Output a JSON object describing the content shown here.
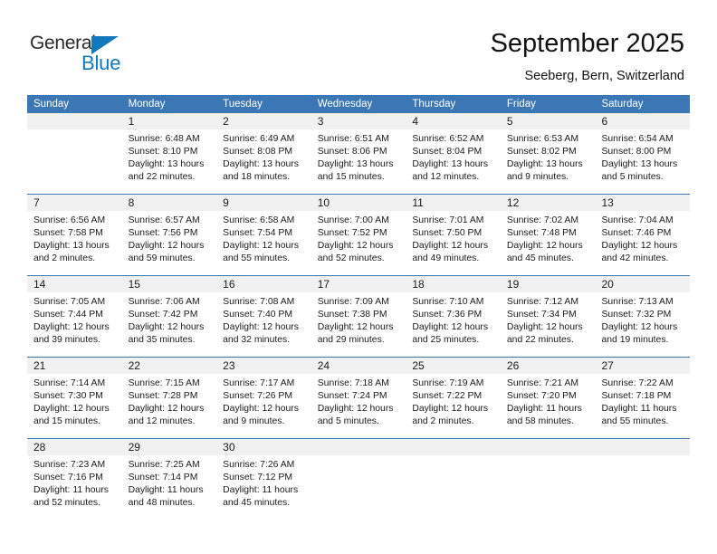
{
  "brand": {
    "name_top": "General",
    "name_bottom": "Blue",
    "color_blue": "#1278be",
    "color_dark": "#2b2b2b",
    "triangle_icon": "blue-triangle-icon"
  },
  "header": {
    "title": "September 2025",
    "subtitle": "Seeberg, Bern, Switzerland"
  },
  "theme": {
    "header_blue": "#3c77b5",
    "band_gray": "#f1f1f1",
    "text_dark": "#1a1a1a"
  },
  "weekdays": [
    "Sunday",
    "Monday",
    "Tuesday",
    "Wednesday",
    "Thursday",
    "Friday",
    "Saturday"
  ],
  "weeks": [
    [
      {
        "day": "",
        "sunrise": "",
        "sunset": "",
        "daylight1": "",
        "daylight2": ""
      },
      {
        "day": "1",
        "sunrise": "Sunrise: 6:48 AM",
        "sunset": "Sunset: 8:10 PM",
        "daylight1": "Daylight: 13 hours",
        "daylight2": "and 22 minutes."
      },
      {
        "day": "2",
        "sunrise": "Sunrise: 6:49 AM",
        "sunset": "Sunset: 8:08 PM",
        "daylight1": "Daylight: 13 hours",
        "daylight2": "and 18 minutes."
      },
      {
        "day": "3",
        "sunrise": "Sunrise: 6:51 AM",
        "sunset": "Sunset: 8:06 PM",
        "daylight1": "Daylight: 13 hours",
        "daylight2": "and 15 minutes."
      },
      {
        "day": "4",
        "sunrise": "Sunrise: 6:52 AM",
        "sunset": "Sunset: 8:04 PM",
        "daylight1": "Daylight: 13 hours",
        "daylight2": "and 12 minutes."
      },
      {
        "day": "5",
        "sunrise": "Sunrise: 6:53 AM",
        "sunset": "Sunset: 8:02 PM",
        "daylight1": "Daylight: 13 hours",
        "daylight2": "and 9 minutes."
      },
      {
        "day": "6",
        "sunrise": "Sunrise: 6:54 AM",
        "sunset": "Sunset: 8:00 PM",
        "daylight1": "Daylight: 13 hours",
        "daylight2": "and 5 minutes."
      }
    ],
    [
      {
        "day": "7",
        "sunrise": "Sunrise: 6:56 AM",
        "sunset": "Sunset: 7:58 PM",
        "daylight1": "Daylight: 13 hours",
        "daylight2": "and 2 minutes."
      },
      {
        "day": "8",
        "sunrise": "Sunrise: 6:57 AM",
        "sunset": "Sunset: 7:56 PM",
        "daylight1": "Daylight: 12 hours",
        "daylight2": "and 59 minutes."
      },
      {
        "day": "9",
        "sunrise": "Sunrise: 6:58 AM",
        "sunset": "Sunset: 7:54 PM",
        "daylight1": "Daylight: 12 hours",
        "daylight2": "and 55 minutes."
      },
      {
        "day": "10",
        "sunrise": "Sunrise: 7:00 AM",
        "sunset": "Sunset: 7:52 PM",
        "daylight1": "Daylight: 12 hours",
        "daylight2": "and 52 minutes."
      },
      {
        "day": "11",
        "sunrise": "Sunrise: 7:01 AM",
        "sunset": "Sunset: 7:50 PM",
        "daylight1": "Daylight: 12 hours",
        "daylight2": "and 49 minutes."
      },
      {
        "day": "12",
        "sunrise": "Sunrise: 7:02 AM",
        "sunset": "Sunset: 7:48 PM",
        "daylight1": "Daylight: 12 hours",
        "daylight2": "and 45 minutes."
      },
      {
        "day": "13",
        "sunrise": "Sunrise: 7:04 AM",
        "sunset": "Sunset: 7:46 PM",
        "daylight1": "Daylight: 12 hours",
        "daylight2": "and 42 minutes."
      }
    ],
    [
      {
        "day": "14",
        "sunrise": "Sunrise: 7:05 AM",
        "sunset": "Sunset: 7:44 PM",
        "daylight1": "Daylight: 12 hours",
        "daylight2": "and 39 minutes."
      },
      {
        "day": "15",
        "sunrise": "Sunrise: 7:06 AM",
        "sunset": "Sunset: 7:42 PM",
        "daylight1": "Daylight: 12 hours",
        "daylight2": "and 35 minutes."
      },
      {
        "day": "16",
        "sunrise": "Sunrise: 7:08 AM",
        "sunset": "Sunset: 7:40 PM",
        "daylight1": "Daylight: 12 hours",
        "daylight2": "and 32 minutes."
      },
      {
        "day": "17",
        "sunrise": "Sunrise: 7:09 AM",
        "sunset": "Sunset: 7:38 PM",
        "daylight1": "Daylight: 12 hours",
        "daylight2": "and 29 minutes."
      },
      {
        "day": "18",
        "sunrise": "Sunrise: 7:10 AM",
        "sunset": "Sunset: 7:36 PM",
        "daylight1": "Daylight: 12 hours",
        "daylight2": "and 25 minutes."
      },
      {
        "day": "19",
        "sunrise": "Sunrise: 7:12 AM",
        "sunset": "Sunset: 7:34 PM",
        "daylight1": "Daylight: 12 hours",
        "daylight2": "and 22 minutes."
      },
      {
        "day": "20",
        "sunrise": "Sunrise: 7:13 AM",
        "sunset": "Sunset: 7:32 PM",
        "daylight1": "Daylight: 12 hours",
        "daylight2": "and 19 minutes."
      }
    ],
    [
      {
        "day": "21",
        "sunrise": "Sunrise: 7:14 AM",
        "sunset": "Sunset: 7:30 PM",
        "daylight1": "Daylight: 12 hours",
        "daylight2": "and 15 minutes."
      },
      {
        "day": "22",
        "sunrise": "Sunrise: 7:15 AM",
        "sunset": "Sunset: 7:28 PM",
        "daylight1": "Daylight: 12 hours",
        "daylight2": "and 12 minutes."
      },
      {
        "day": "23",
        "sunrise": "Sunrise: 7:17 AM",
        "sunset": "Sunset: 7:26 PM",
        "daylight1": "Daylight: 12 hours",
        "daylight2": "and 9 minutes."
      },
      {
        "day": "24",
        "sunrise": "Sunrise: 7:18 AM",
        "sunset": "Sunset: 7:24 PM",
        "daylight1": "Daylight: 12 hours",
        "daylight2": "and 5 minutes."
      },
      {
        "day": "25",
        "sunrise": "Sunrise: 7:19 AM",
        "sunset": "Sunset: 7:22 PM",
        "daylight1": "Daylight: 12 hours",
        "daylight2": "and 2 minutes."
      },
      {
        "day": "26",
        "sunrise": "Sunrise: 7:21 AM",
        "sunset": "Sunset: 7:20 PM",
        "daylight1": "Daylight: 11 hours",
        "daylight2": "and 58 minutes."
      },
      {
        "day": "27",
        "sunrise": "Sunrise: 7:22 AM",
        "sunset": "Sunset: 7:18 PM",
        "daylight1": "Daylight: 11 hours",
        "daylight2": "and 55 minutes."
      }
    ],
    [
      {
        "day": "28",
        "sunrise": "Sunrise: 7:23 AM",
        "sunset": "Sunset: 7:16 PM",
        "daylight1": "Daylight: 11 hours",
        "daylight2": "and 52 minutes."
      },
      {
        "day": "29",
        "sunrise": "Sunrise: 7:25 AM",
        "sunset": "Sunset: 7:14 PM",
        "daylight1": "Daylight: 11 hours",
        "daylight2": "and 48 minutes."
      },
      {
        "day": "30",
        "sunrise": "Sunrise: 7:26 AM",
        "sunset": "Sunset: 7:12 PM",
        "daylight1": "Daylight: 11 hours",
        "daylight2": "and 45 minutes."
      },
      {
        "day": "",
        "sunrise": "",
        "sunset": "",
        "daylight1": "",
        "daylight2": ""
      },
      {
        "day": "",
        "sunrise": "",
        "sunset": "",
        "daylight1": "",
        "daylight2": ""
      },
      {
        "day": "",
        "sunrise": "",
        "sunset": "",
        "daylight1": "",
        "daylight2": ""
      },
      {
        "day": "",
        "sunrise": "",
        "sunset": "",
        "daylight1": "",
        "daylight2": ""
      }
    ]
  ]
}
